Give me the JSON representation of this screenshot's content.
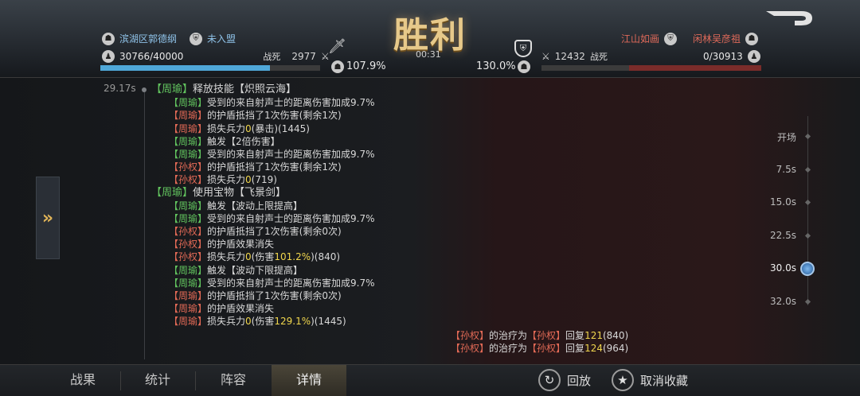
{
  "header": {
    "title": "胜利",
    "timer": "00:31",
    "left": {
      "name": "滨湖区郭德纲",
      "alliance": "未入盟",
      "troops": "30766/40000",
      "kill_label": "战死",
      "kill_value": "2977",
      "percent": "107.9%",
      "hp_fraction": 0.77
    },
    "right": {
      "name": "闲林吴彦祖",
      "alliance": "江山如画",
      "troops": "0/30913",
      "kill_label": "战死",
      "kill_value": "12432",
      "percent": "130.0%",
      "hp_fraction": 0.0
    }
  },
  "log": {
    "timestamp": "29.17s",
    "lines": [
      {
        "level": 1,
        "segs": [
          {
            "t": "【周瑜】",
            "c": "g"
          },
          {
            "t": "释放技能【炽照云海】"
          }
        ]
      },
      {
        "level": 2,
        "segs": [
          {
            "t": "【周瑜】",
            "c": "g"
          },
          {
            "t": "受到的来自射声士的距离伤害加成9.7%"
          }
        ]
      },
      {
        "level": 2,
        "segs": [
          {
            "t": "【周瑜】",
            "c": "r"
          },
          {
            "t": "的护盾抵挡了1次伤害(剩余1次)"
          }
        ]
      },
      {
        "level": 2,
        "segs": [
          {
            "t": "【周瑜】",
            "c": "r"
          },
          {
            "t": "损失兵力"
          },
          {
            "t": "0",
            "c": "y"
          },
          {
            "t": "(暴击)(1445)"
          }
        ]
      },
      {
        "level": 2,
        "segs": [
          {
            "t": "【周瑜】",
            "c": "g"
          },
          {
            "t": "触发【2倍伤害】"
          }
        ]
      },
      {
        "level": 2,
        "segs": [
          {
            "t": "【周瑜】",
            "c": "g"
          },
          {
            "t": "受到的来自射声士的距离伤害加成9.7%"
          }
        ]
      },
      {
        "level": 2,
        "segs": [
          {
            "t": "【孙权】",
            "c": "r"
          },
          {
            "t": "的护盾抵挡了1次伤害(剩余1次)"
          }
        ]
      },
      {
        "level": 2,
        "segs": [
          {
            "t": "【孙权】",
            "c": "r"
          },
          {
            "t": "损失兵力"
          },
          {
            "t": "0",
            "c": "y"
          },
          {
            "t": "(719)"
          }
        ]
      },
      {
        "level": 1,
        "segs": [
          {
            "t": "【周瑜】",
            "c": "g"
          },
          {
            "t": "使用宝物【飞景剑】"
          }
        ]
      },
      {
        "level": 2,
        "segs": [
          {
            "t": "【周瑜】",
            "c": "g"
          },
          {
            "t": "触发【波动上限提高】"
          }
        ]
      },
      {
        "level": 2,
        "segs": [
          {
            "t": "【周瑜】",
            "c": "g"
          },
          {
            "t": "受到的来自射声士的距离伤害加成9.7%"
          }
        ]
      },
      {
        "level": 2,
        "segs": [
          {
            "t": "【孙权】",
            "c": "r"
          },
          {
            "t": "的护盾抵挡了1次伤害(剩余0次)"
          }
        ]
      },
      {
        "level": 2,
        "segs": [
          {
            "t": "【孙权】",
            "c": "r"
          },
          {
            "t": "的护盾效果消失"
          }
        ]
      },
      {
        "level": 2,
        "segs": [
          {
            "t": "【孙权】",
            "c": "r"
          },
          {
            "t": "损失兵力"
          },
          {
            "t": "0",
            "c": "y"
          },
          {
            "t": "(伤害"
          },
          {
            "t": "101.2%",
            "c": "y"
          },
          {
            "t": ")(840)"
          }
        ]
      },
      {
        "level": 2,
        "segs": [
          {
            "t": "【周瑜】",
            "c": "g"
          },
          {
            "t": "触发【波动下限提高】"
          }
        ]
      },
      {
        "level": 2,
        "segs": [
          {
            "t": "【周瑜】",
            "c": "g"
          },
          {
            "t": "受到的来自射声士的距离伤害加成9.7%"
          }
        ]
      },
      {
        "level": 2,
        "segs": [
          {
            "t": "【周瑜】",
            "c": "r"
          },
          {
            "t": "的护盾抵挡了1次伤害(剩余0次)"
          }
        ]
      },
      {
        "level": 2,
        "segs": [
          {
            "t": "【周瑜】",
            "c": "r"
          },
          {
            "t": "的护盾效果消失"
          }
        ]
      },
      {
        "level": 2,
        "segs": [
          {
            "t": "【周瑜】",
            "c": "r"
          },
          {
            "t": "损失兵力"
          },
          {
            "t": "0",
            "c": "y"
          },
          {
            "t": "(伤害"
          },
          {
            "t": "129.1%",
            "c": "y"
          },
          {
            "t": ")(1445)"
          }
        ]
      }
    ],
    "heal_lines": [
      [
        {
          "t": "【孙权】",
          "c": "r"
        },
        {
          "t": "的治疗为"
        },
        {
          "t": "【孙权】",
          "c": "r"
        },
        {
          "t": "回复"
        },
        {
          "t": "121",
          "c": "y"
        },
        {
          "t": "(840)"
        }
      ],
      [
        {
          "t": "【孙权】",
          "c": "r"
        },
        {
          "t": "的治疗为"
        },
        {
          "t": "【孙权】",
          "c": "r"
        },
        {
          "t": "回复"
        },
        {
          "t": "124",
          "c": "y"
        },
        {
          "t": "(964)"
        }
      ]
    ]
  },
  "timeline": {
    "marks": [
      "开场",
      "7.5s",
      "15.0s",
      "22.5s",
      "30.0s",
      "32.0s"
    ],
    "active_index": 4
  },
  "footer": {
    "tabs": [
      "战果",
      "统计",
      "阵容",
      "详情"
    ],
    "active_tab": 3,
    "replay_label": "回放",
    "unfavorite_label": "取消收藏"
  },
  "colors": {
    "ally": "#62c45e",
    "enemy": "#e36a56",
    "number": "#f0d64d",
    "accent_blue": "#4fa7d8",
    "accent_red": "#a43a36"
  }
}
